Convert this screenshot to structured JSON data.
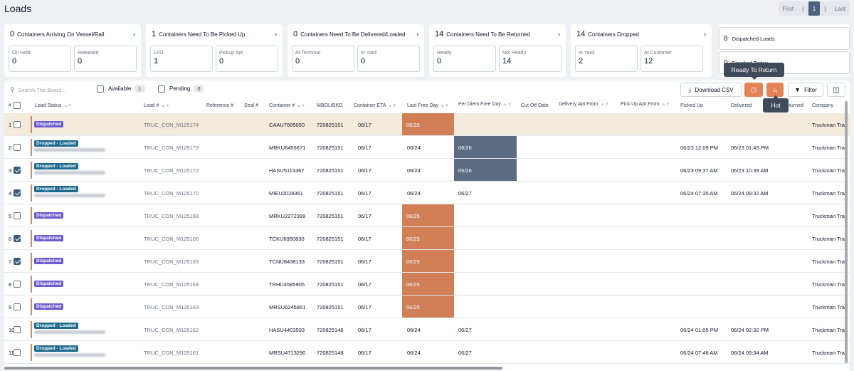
{
  "title": "Loads",
  "pager": {
    "first": "First",
    "prev": "(",
    "current": "1",
    "next": ")",
    "last": "Last"
  },
  "cards": [
    {
      "count": "0",
      "label": "Containers Arriving On Vessel/Rail",
      "subs": [
        {
          "label": "On Hold",
          "value": "0"
        },
        {
          "label": "Released",
          "value": "0"
        }
      ]
    },
    {
      "count": "1",
      "label": "Containers Need To Be Picked Up",
      "subs": [
        {
          "label": "LFD",
          "value": "1"
        },
        {
          "label": "Pickup Apt",
          "value": "0"
        }
      ]
    },
    {
      "count": "0",
      "label": "Containers Need To Be Delivered/Loaded",
      "subs": [
        {
          "label": "At Terminal",
          "value": "0"
        },
        {
          "label": "In Yard",
          "value": "0"
        }
      ]
    },
    {
      "count": "14",
      "label": "Containers Need To Be Returned",
      "subs": [
        {
          "label": "Ready",
          "value": "0"
        },
        {
          "label": "Not Ready",
          "value": "14"
        }
      ]
    },
    {
      "count": "14",
      "label": "Containers Dropped",
      "subs": [
        {
          "label": "In Yard",
          "value": "2"
        },
        {
          "label": "At Customer",
          "value": "12"
        }
      ]
    }
  ],
  "side": [
    {
      "count": "8",
      "label": "Dispatched Loads"
    },
    {
      "count": "0",
      "label": "Finished Today"
    }
  ],
  "tooltips": {
    "ready": "Ready To Return",
    "hot": "Hot"
  },
  "toolbar": {
    "search_placeholder": "Search The Board...",
    "available_label": "Available",
    "available_count": "1",
    "pending_label": "Pending",
    "pending_count": "0",
    "download_label": "Download CSV",
    "filter_label": "Filter"
  },
  "columns": [
    "#",
    "Load Status",
    "Load #",
    "Reference #",
    "Seal #",
    "Container #",
    "MBOL/BKG",
    "Container ETA",
    "Last Free Day",
    "Per Diem Free Day",
    "Cut Off Date",
    "Delivery Apt From",
    "Pick Up Apt From",
    "Picked Up",
    "Delivered",
    "Returned",
    "Company"
  ],
  "rows": [
    {
      "n": "1",
      "checked": false,
      "status": "Dispatched",
      "load": "TRUC_CON_M125174",
      "container": "CAAU7685050",
      "mbol": "720825151",
      "eta": "06/17",
      "lfd": "06/25",
      "lfd_hl": true,
      "pd": "",
      "pd_hl": false,
      "picked": "",
      "delivered": "",
      "company": "Truckman Tra",
      "highlight": true
    },
    {
      "n": "2",
      "checked": false,
      "status": "Dropped - Loaded",
      "load": "TRUC_CON_M125173",
      "container": "MRKU6456671",
      "mbol": "720825151",
      "eta": "06/17",
      "lfd": "06/24",
      "lfd_hl": false,
      "pd": "06/26",
      "pd_hl": true,
      "picked": "06/23 12:09 PM",
      "delivered": "06/23 01:43 PM",
      "company": "Truckman Tra",
      "highlight": false
    },
    {
      "n": "3",
      "checked": true,
      "status": "Dropped - Loaded",
      "load": "TRUC_CON_M125172",
      "container": "HASU5113367",
      "mbol": "720825151",
      "eta": "06/17",
      "lfd": "06/24",
      "lfd_hl": false,
      "pd": "06/26",
      "pd_hl": true,
      "picked": "06/23 09:37 AM",
      "delivered": "06/23 10:39 AM",
      "company": "Truckman Tra",
      "highlight": false
    },
    {
      "n": "4",
      "checked": true,
      "status": "Dropped - Loaded",
      "load": "TRUC_CON_M125170",
      "container": "MIEU2028361",
      "mbol": "720825151",
      "eta": "06/17",
      "lfd": "06/24",
      "lfd_hl": false,
      "pd": "06/27",
      "pd_hl": false,
      "picked": "06/24 07:35 AM",
      "delivered": "06/24 09:32 AM",
      "company": "Truckman Tra",
      "highlight": false
    },
    {
      "n": "5",
      "checked": false,
      "status": "Dispatched",
      "load": "TRUC_CON_M125168",
      "container": "MRKU2272399",
      "mbol": "720825151",
      "eta": "06/17",
      "lfd": "06/25",
      "lfd_hl": true,
      "pd": "",
      "pd_hl": false,
      "picked": "",
      "delivered": "",
      "company": "Truckman Tra",
      "highlight": false
    },
    {
      "n": "6",
      "checked": true,
      "status": "Dispatched",
      "load": "TRUC_CON_M125166",
      "container": "TCKU6950830",
      "mbol": "720825151",
      "eta": "06/17",
      "lfd": "06/25",
      "lfd_hl": true,
      "pd": "",
      "pd_hl": false,
      "picked": "",
      "delivered": "",
      "company": "Truckman Tra",
      "highlight": false
    },
    {
      "n": "7",
      "checked": true,
      "status": "Dispatched",
      "load": "TRUC_CON_M125165",
      "container": "TCNU8438133",
      "mbol": "720825151",
      "eta": "06/17",
      "lfd": "06/25",
      "lfd_hl": true,
      "pd": "",
      "pd_hl": false,
      "picked": "",
      "delivered": "",
      "company": "Truckman Tra",
      "highlight": false
    },
    {
      "n": "8",
      "checked": false,
      "status": "Dispatched",
      "load": "TRUC_CON_M125164",
      "container": "TRHU4585905",
      "mbol": "720825151",
      "eta": "06/17",
      "lfd": "06/25",
      "lfd_hl": true,
      "pd": "",
      "pd_hl": false,
      "picked": "",
      "delivered": "",
      "company": "Truckman Tra",
      "highlight": false
    },
    {
      "n": "9",
      "checked": false,
      "status": "Dispatched",
      "load": "TRUC_CON_M125163",
      "container": "MRSU6245861",
      "mbol": "720825151",
      "eta": "06/17",
      "lfd": "06/25",
      "lfd_hl": true,
      "pd": "",
      "pd_hl": false,
      "picked": "",
      "delivered": "",
      "company": "Truckman Tra",
      "highlight": false
    },
    {
      "n": "10",
      "checked": false,
      "status": "Dropped - Loaded",
      "load": "TRUC_CON_M125162",
      "container": "HASU4403593",
      "mbol": "720825148",
      "eta": "06/17",
      "lfd": "06/24",
      "lfd_hl": false,
      "pd": "06/27",
      "pd_hl": false,
      "picked": "06/24 01:05 PM",
      "delivered": "06/24 02:32 PM",
      "company": "Truckman Tra",
      "highlight": false
    },
    {
      "n": "11",
      "checked": false,
      "status": "Dropped - Loaded",
      "load": "TRUC_CON_M125161",
      "container": "MRSU4713290",
      "mbol": "720825148",
      "eta": "06/17",
      "lfd": "06/24",
      "lfd_hl": false,
      "pd": "06/27",
      "pd_hl": false,
      "picked": "06/24 07:46 AM",
      "delivered": "06/24 09:34 AM",
      "company": "Truckman Tra",
      "highlight": false
    }
  ],
  "colors": {
    "accent": "#3b5a7e",
    "orange": "#d07f57",
    "slate": "#5b6b82",
    "dispatched": "#6d5ccf",
    "dropped": "#1e6a8f"
  }
}
